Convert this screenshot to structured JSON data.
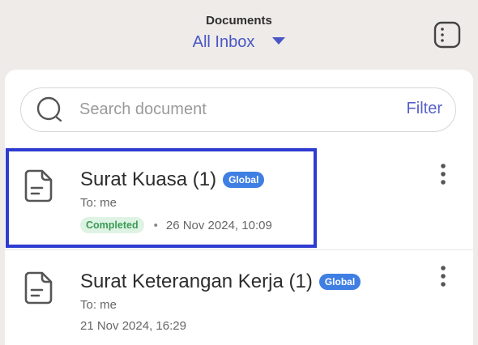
{
  "header": {
    "title": "Documents",
    "inbox_label": "All Inbox"
  },
  "search": {
    "placeholder": "Search document",
    "filter_label": "Filter"
  },
  "documents": [
    {
      "title": "Surat Kuasa (1)",
      "badge": "Global",
      "to": "To: me",
      "status": "Completed",
      "separator": "•",
      "date": "26 Nov 2024, 10:09"
    },
    {
      "title": "Surat Keterangan Kerja (1)",
      "badge": "Global",
      "to": "To: me",
      "date": "21 Nov 2024, 16:29"
    }
  ],
  "colors": {
    "accent": "#4a56c6",
    "badge_global": "#3f7fe3",
    "status_completed": "#3a9a55",
    "highlight_border": "#2d3bd0"
  },
  "icons": {
    "search": "search-icon",
    "document": "document-icon",
    "menu": "menu-grid-icon",
    "more": "more-vertical-icon",
    "dropdown": "chevron-down-icon"
  }
}
